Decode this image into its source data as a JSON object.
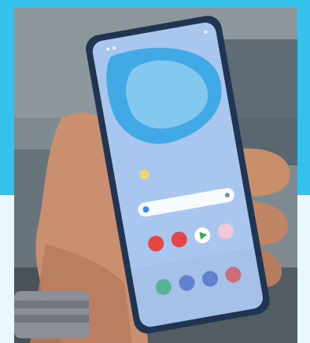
{
  "image": {
    "subject": "smartphone-in-hand",
    "accent_top": "#34c2ea",
    "accent_bottom": "#e9f8fd",
    "wallpaper_color": "#3aa6e6",
    "phone_frame_color": "#1f3552",
    "app_icons_row1": [
      "red-app-icon",
      "red-app-icon",
      "play-store-icon",
      "photo-app-icon"
    ],
    "dock_icons": [
      "phone-icon",
      "messages-icon",
      "chat-icon",
      "camera-icon"
    ],
    "search_bar_icon": "google-icon"
  }
}
